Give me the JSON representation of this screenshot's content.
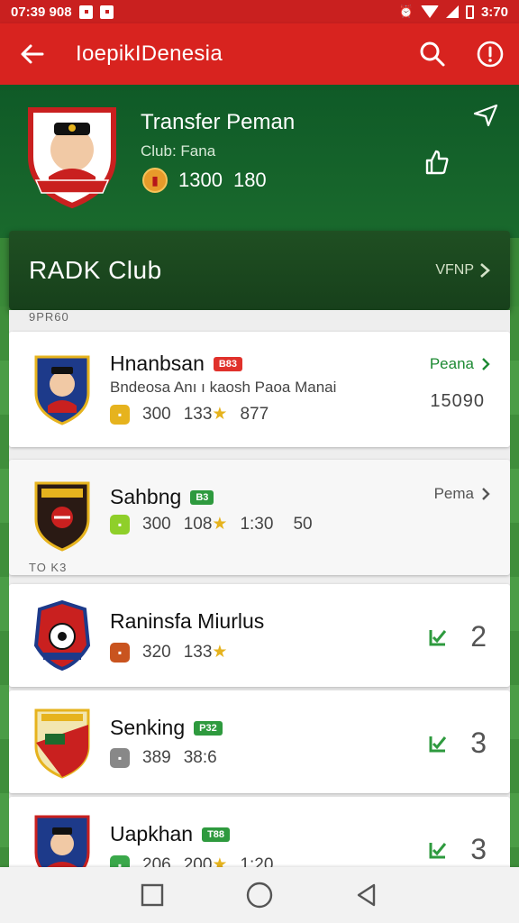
{
  "status_bar": {
    "left_text": "07:39 908",
    "right_text": "3:70"
  },
  "app_bar": {
    "title": "IoepikIDenesia"
  },
  "header": {
    "title": "Transfer Peman",
    "subtitle": "Club: Fana",
    "stat_a": "1300",
    "stat_b": "180"
  },
  "club_bar": {
    "name": "RADK Club",
    "more_label": "VFNP"
  },
  "list": {
    "section_top": "9PR60",
    "section_mid": "TO K3",
    "players": [
      {
        "name": "Hnanbsan",
        "badge": "B83",
        "badge_color": "red",
        "desc": "Bndeosa Anı ı kaosh Paoa Manai",
        "stats": [
          "300",
          "133",
          "877"
        ],
        "link": "Peana",
        "value": "15090",
        "chip_color": "#e6b31e"
      },
      {
        "name": "Sahbng",
        "badge": "B3",
        "badge_color": "green",
        "stats": [
          "300",
          "108",
          "1:30",
          "50"
        ],
        "link": "Pema",
        "chip_color": "#8fcf2a"
      },
      {
        "name": "Raninsfa Miurlus",
        "stats": [
          "320",
          "133"
        ],
        "rank": "2",
        "chip_color": "#c9541f"
      },
      {
        "name": "Senking",
        "badge": "P32",
        "badge_color": "green",
        "stats": [
          "389",
          "38:6"
        ],
        "rank": "3",
        "chip_color": "#888888"
      },
      {
        "name": "Uapkhan",
        "badge": "T88",
        "badge_color": "green",
        "stats": [
          "206",
          "200",
          "1:20"
        ],
        "rank": "3",
        "chip_color": "#3aa84a"
      }
    ]
  },
  "colors": {
    "primary_red": "#d8231f",
    "header_green": "#0f5a27",
    "link_green": "#1d8a33"
  }
}
